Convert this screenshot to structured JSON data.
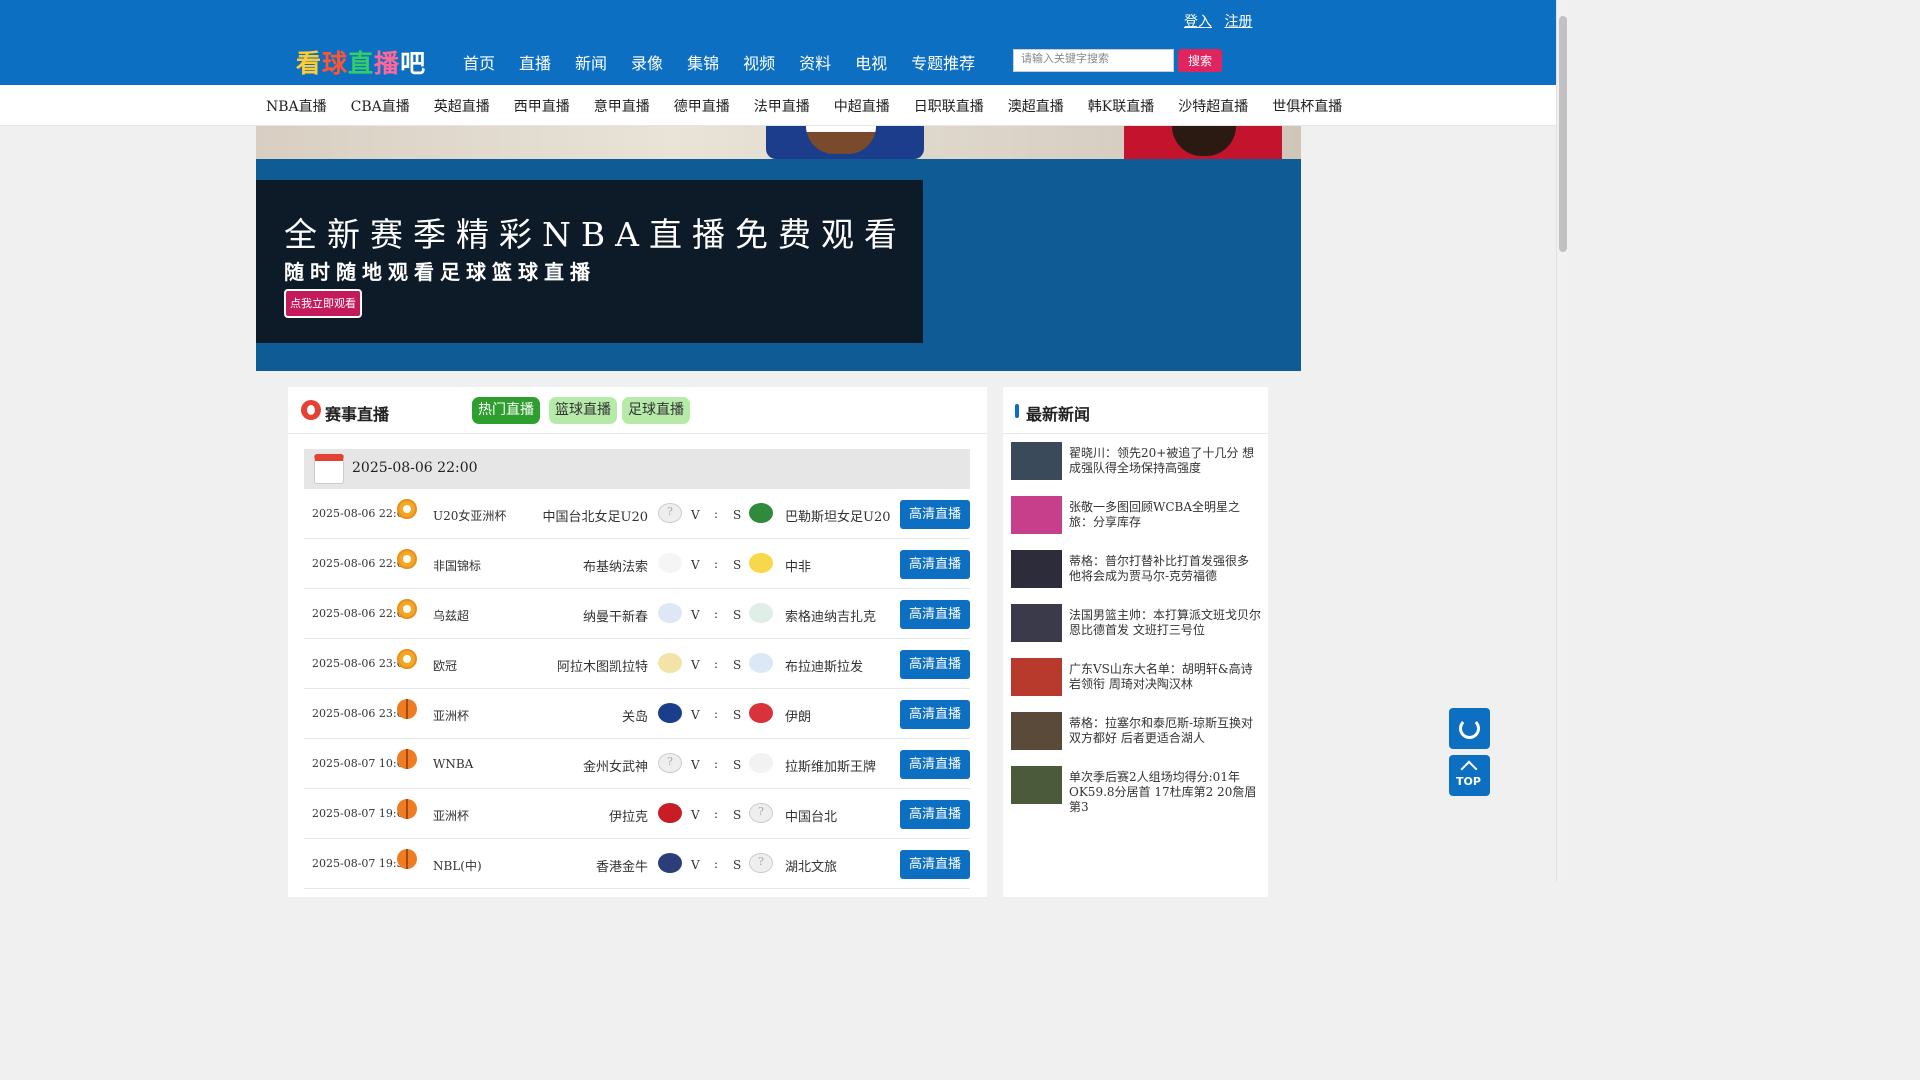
{
  "auth": {
    "login": "登入",
    "register": "注册"
  },
  "logo": {
    "c1": "看",
    "c2": "球",
    "c3": "直",
    "c4": "播",
    "c5": "吧"
  },
  "main_nav": [
    "首页",
    "直播",
    "新闻",
    "录像",
    "集锦",
    "视频",
    "资料",
    "电视",
    "专题推荐"
  ],
  "search": {
    "placeholder": "请输入关键字搜索",
    "button": "搜索"
  },
  "sub_nav": [
    "NBA直播",
    "CBA直播",
    "英超直播",
    "西甲直播",
    "意甲直播",
    "德甲直播",
    "法甲直播",
    "中超直播",
    "日职联直播",
    "澳超直播",
    "韩K联直播",
    "沙特超直播",
    "世俱杯直播"
  ],
  "banner": {
    "headline": "全新赛季精彩NBA直播免费观看",
    "subline": "随时随地观看足球篮球直播",
    "button": "点我立即观看"
  },
  "live": {
    "title": "赛事直播",
    "tabs": [
      "热门直播",
      "篮球直播",
      "足球直播"
    ],
    "date": "2025-08-06 22:00",
    "v": "V",
    "colon": ":",
    "s": "S",
    "matches": [
      {
        "time": "2025-08-06 22:00",
        "sport": "soccer",
        "league": "U20女亚洲杯",
        "home": "中国台北女足U20",
        "away": "巴勒斯坦女足U20",
        "button": "高清直播"
      },
      {
        "time": "2025-08-06 22:00",
        "sport": "soccer",
        "league": "非国锦标",
        "home": "布基纳法索",
        "away": "中非",
        "button": "高清直播"
      },
      {
        "time": "2025-08-06 22:00",
        "sport": "soccer",
        "league": "乌兹超",
        "home": "纳曼干新春",
        "away": "索格迪纳吉扎克",
        "button": "高清直播"
      },
      {
        "time": "2025-08-06 23:00",
        "sport": "soccer",
        "league": "欧冠",
        "home": "阿拉木图凯拉特",
        "away": "布拉迪斯拉发",
        "button": "高清直播"
      },
      {
        "time": "2025-08-06 23:00",
        "sport": "basketball",
        "league": "亚洲杯",
        "home": "关岛",
        "away": "伊朗",
        "button": "高清直播"
      },
      {
        "time": "2025-08-07 10:00",
        "sport": "basketball",
        "league": "WNBA",
        "home": "金州女武神",
        "away": "拉斯维加斯王牌",
        "button": "高清直播"
      },
      {
        "time": "2025-08-07 19:00",
        "sport": "basketball",
        "league": "亚洲杯",
        "home": "伊拉克",
        "away": "中国台北",
        "button": "高清直播"
      },
      {
        "time": "2025-08-07 19:30",
        "sport": "basketball",
        "league": "NBL(中)",
        "home": "香港金牛",
        "away": "湖北文旅",
        "button": "高清直播"
      }
    ]
  },
  "news": {
    "title": "最新新闻",
    "items": [
      "翟晓川：领先20+被追了十几分 想成强队得全场保持高强度",
      "张敬一多图回顾WCBA全明星之旅：分享库存",
      "蒂格：普尔打替补比打首发强很多 他将会成为贾马尔-克劳福德",
      "法国男篮主帅：本打算派文班戈贝尔恩比德首发 文班打三号位",
      "广东VS山东大名单：胡明轩&高诗岩领衔 周琦对决陶汉林",
      "蒂格：拉塞尔和泰厄斯-琼斯互换对双方都好 后者更适合湖人",
      "单次季后赛2人组场均得分:01年OK59.8分居首 17杜库第2 20詹眉第3"
    ]
  },
  "float": {
    "top_label": "TOP"
  },
  "colors": {
    "primary": "#0c6fc2",
    "accent": "#e0245e",
    "tab_active": "#2e9e2e",
    "tab_inactive": "#b6eaa9"
  }
}
